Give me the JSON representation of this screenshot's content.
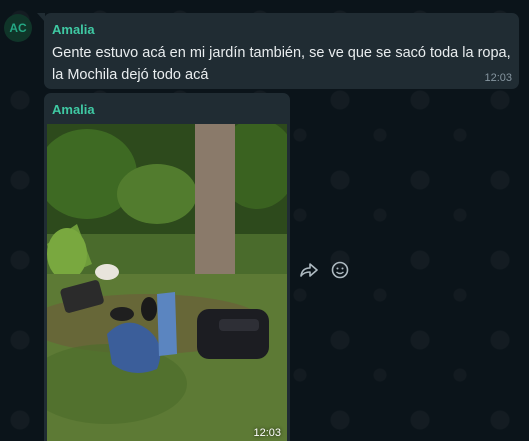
{
  "chat": {
    "avatar_initials": "AC",
    "messages": [
      {
        "sender": "Amalia",
        "text": "Gente estuvo acá en mi jardín también, se ve que se sacó toda la ropa, la Mochila dejó todo acá",
        "time": "12:03"
      },
      {
        "sender": "Amalia",
        "type": "image",
        "time": "12:03"
      }
    ]
  },
  "actions": {
    "forward_icon": "forward-icon",
    "react_icon": "emoji-icon"
  },
  "colors": {
    "background": "#0b141a",
    "bubble": "#202c33",
    "sender_name": "#3fc9a3",
    "text": "#e9edef",
    "timestamp": "#8696a0"
  }
}
